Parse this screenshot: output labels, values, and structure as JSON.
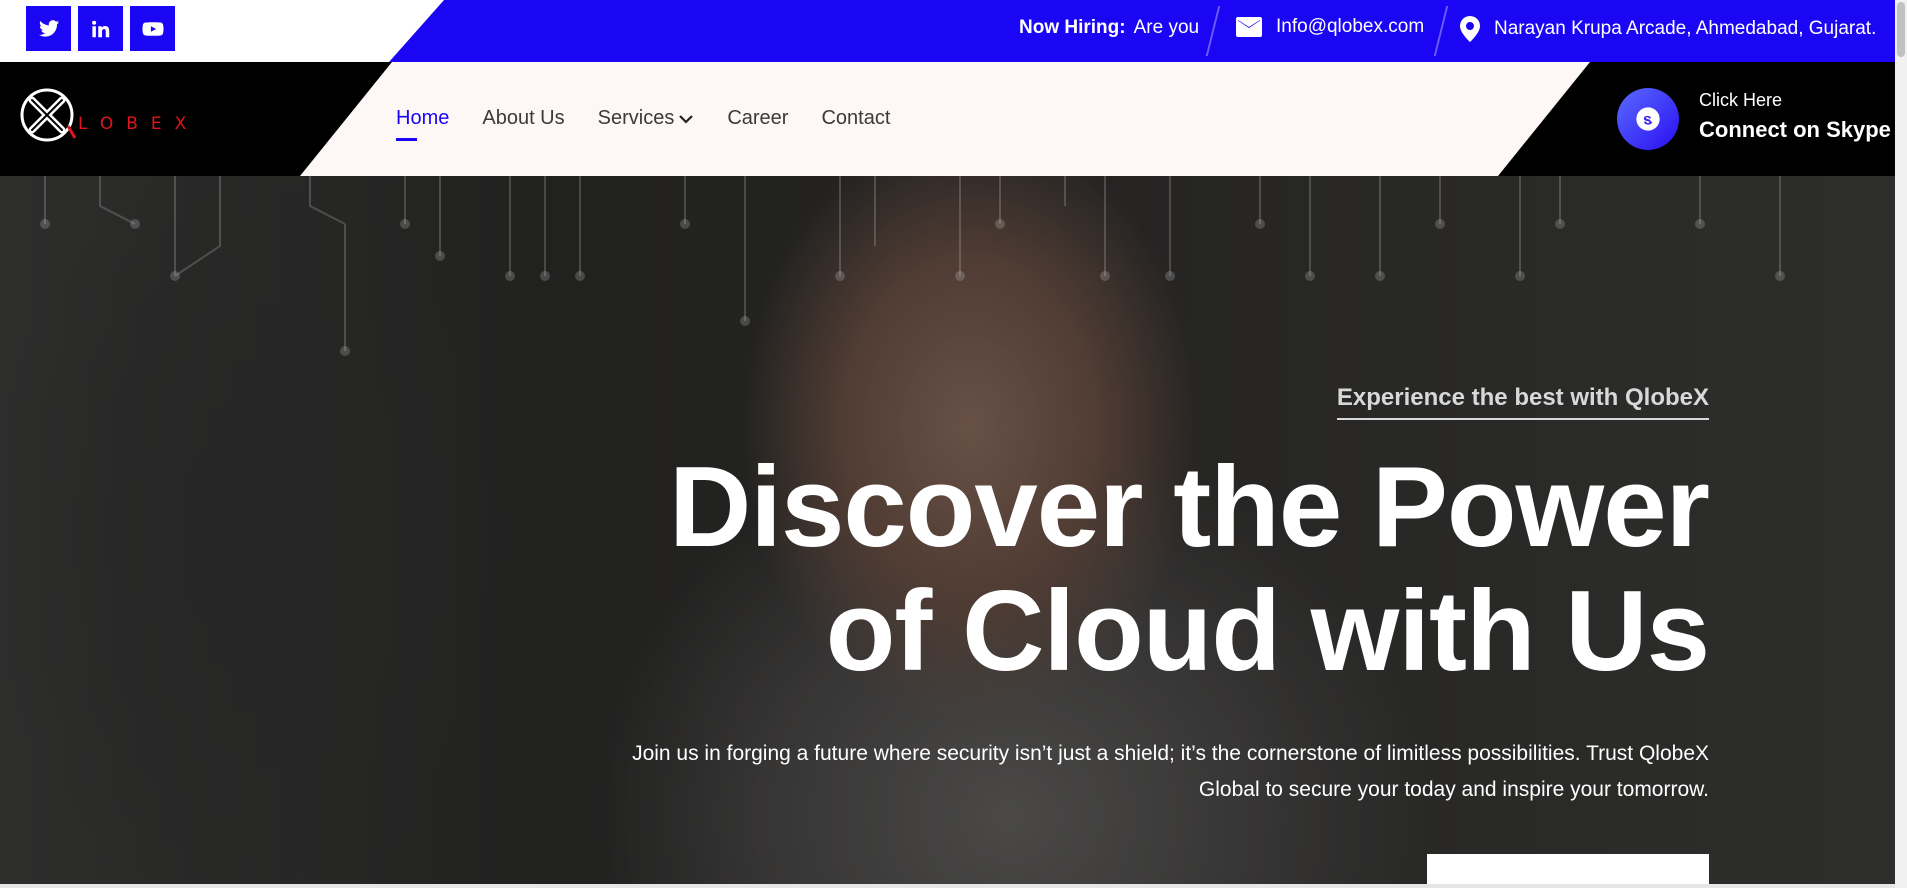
{
  "colors": {
    "brand_blue": "#1a06f5",
    "logo_red": "#e0161b",
    "nav_bg": "#fdf8f6",
    "dark": "#000000"
  },
  "topbar": {
    "social": [
      {
        "icon": "twitter-icon",
        "label": "Twitter"
      },
      {
        "icon": "linkedin-icon",
        "label": "LinkedIn"
      },
      {
        "icon": "youtube-icon",
        "label": "YouTube"
      }
    ],
    "hiring_label": "Now Hiring:",
    "hiring_text": "Are you",
    "email_icon": "envelope-icon",
    "email": "Info@qlobex.com",
    "location_icon": "map-pin-icon",
    "address": "Narayan Krupa Arcade, Ahmedabad, Gujarat."
  },
  "header": {
    "logo_text": "LOBEX",
    "nav": [
      {
        "label": "Home",
        "active": true
      },
      {
        "label": "About Us"
      },
      {
        "label": "Services",
        "has_dropdown": true
      },
      {
        "label": "Career"
      },
      {
        "label": "Contact"
      }
    ],
    "skype_icon": "skype-icon",
    "skype_small": "Click Here",
    "skype_big": "Connect on Skype"
  },
  "hero": {
    "eyebrow": "Experience the best with QlobeX",
    "title_line1": "Discover the Power",
    "title_line2": "of Cloud with Us",
    "text": "Join us in forging a future where security isn’t just a shield; it’s the cornerstone of limitless possibilities. Trust QlobeX Global to secure your today and inspire your tomorrow."
  }
}
